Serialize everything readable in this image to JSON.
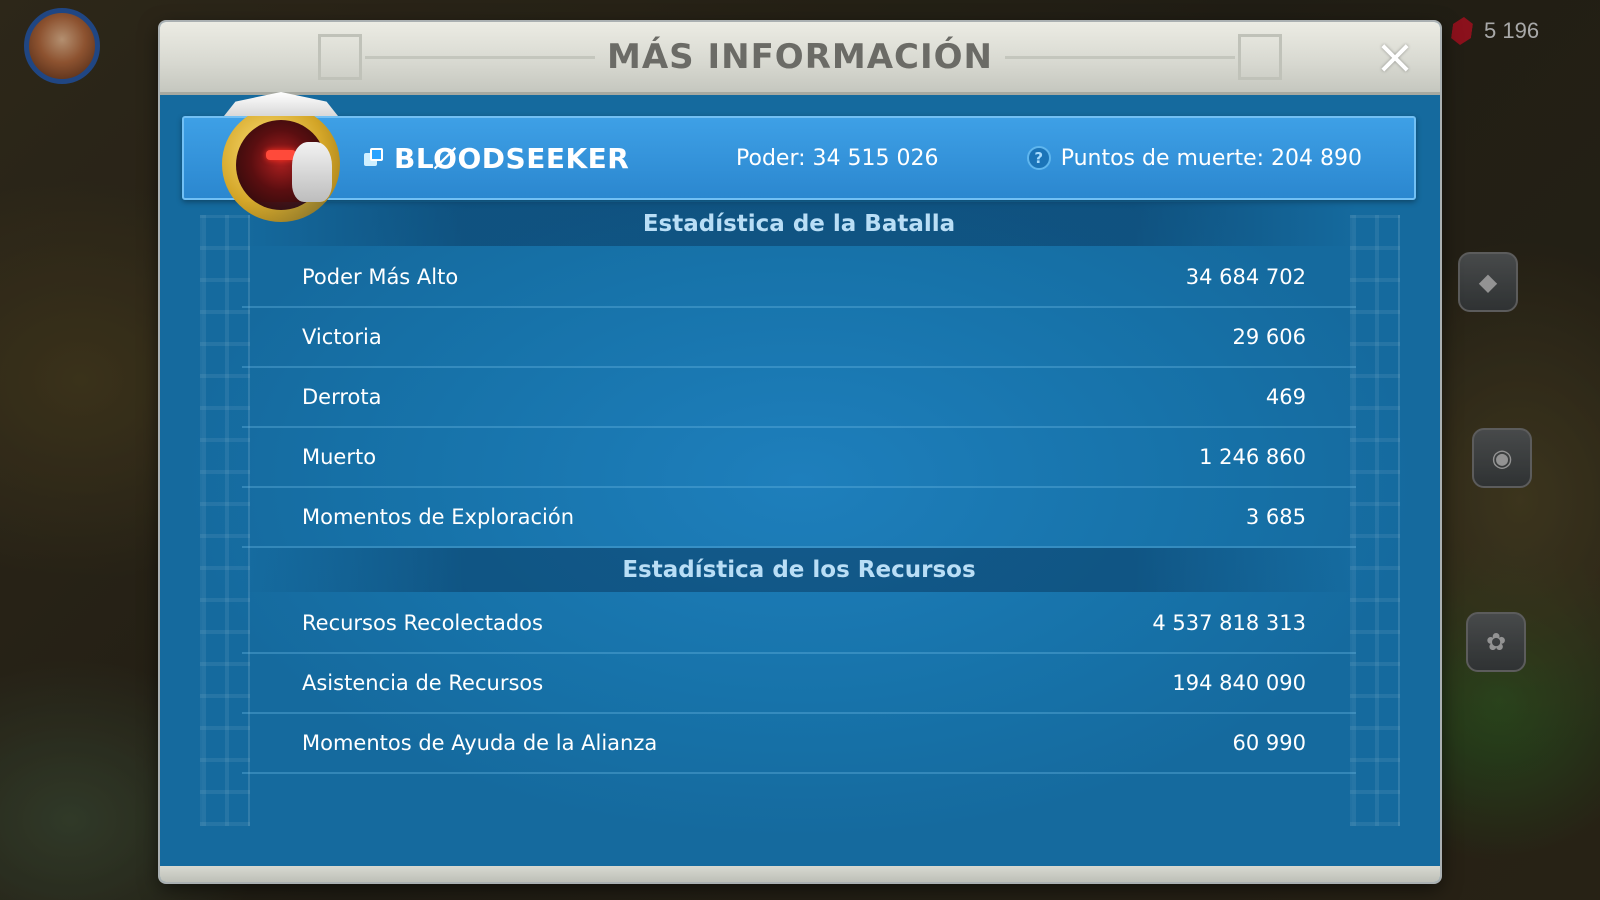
{
  "dialog": {
    "title": "MÁS INFORMACIÓN",
    "close_icon": "×"
  },
  "hud": {
    "gems": "5 196"
  },
  "player": {
    "name": "BLØODSEEKER",
    "power": "Poder: 34 515 026",
    "kill_points": "Puntos de muerte: 204 890",
    "help_icon": "?"
  },
  "battle_stats": {
    "header": "Estadística de la Batalla",
    "rows": [
      {
        "label": "Poder Más Alto",
        "value": "34 684 702"
      },
      {
        "label": "Victoria",
        "value": "29 606"
      },
      {
        "label": "Derrota",
        "value": "469"
      },
      {
        "label": "Muerto",
        "value": "1 246 860"
      },
      {
        "label": "Momentos de Exploración",
        "value": "3 685"
      }
    ]
  },
  "resource_stats": {
    "header": "Estadística de los Recursos",
    "rows": [
      {
        "label": "Recursos Recolectados",
        "value": "4 537 818 313"
      },
      {
        "label": "Asistencia de Recursos",
        "value": "194 840 090"
      },
      {
        "label": "Momentos de Ayuda de la Alianza",
        "value": "60 990"
      }
    ]
  },
  "colors": {
    "panel_blue": "#1a6fa6",
    "card_blue": "#2b87cf",
    "header_text": "#b9def6",
    "title_text": "#6b6b66"
  }
}
